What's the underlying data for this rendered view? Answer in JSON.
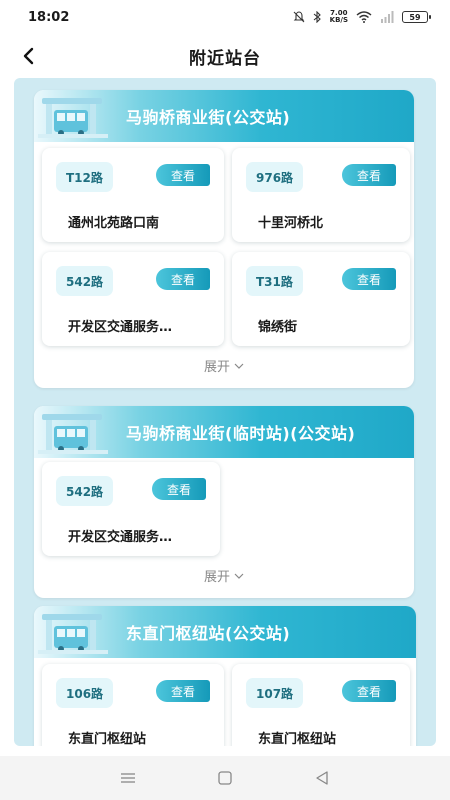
{
  "status_bar": {
    "time": "18:02",
    "net_speed_value": "7.00",
    "net_speed_unit": "KB/S",
    "battery": "59"
  },
  "header": {
    "title": "附近站台"
  },
  "stations": [
    {
      "name": "马驹桥商业街(公交站)",
      "routes": [
        {
          "route": "T12路",
          "stop": "通州北苑路口南",
          "button": "查看"
        },
        {
          "route": "976路",
          "stop": "十里河桥北",
          "button": "查看"
        },
        {
          "route": "542路",
          "stop": "开发区交通服务…",
          "button": "查看"
        },
        {
          "route": "T31路",
          "stop": "锦绣街",
          "button": "查看"
        }
      ],
      "expand_label": "展开"
    },
    {
      "name": "马驹桥商业街(临时站)(公交站)",
      "routes": [
        {
          "route": "542路",
          "stop": "开发区交通服务…",
          "button": "查看"
        }
      ],
      "expand_label": "展开"
    },
    {
      "name": "东直门枢纽站(公交站)",
      "routes": [
        {
          "route": "106路",
          "stop": "东直门枢纽站",
          "button": "查看"
        },
        {
          "route": "107路",
          "stop": "东直门枢纽站",
          "button": "查看"
        }
      ]
    }
  ],
  "icons": {
    "back": "chevron-left-icon",
    "expand": "chevron-down-icon",
    "nav_menu": "menu-icon",
    "nav_home": "home-square-icon",
    "nav_back": "triangle-back-icon"
  },
  "colors": {
    "accent": "#1fa8c8",
    "badge_bg": "#e3f6fa",
    "content_bg": "#cfeaf2"
  }
}
